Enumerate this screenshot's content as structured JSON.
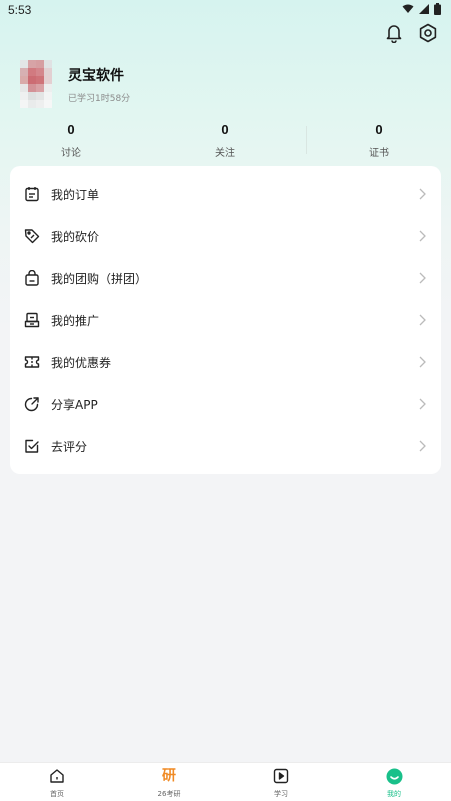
{
  "status": {
    "time": "5:53",
    "icons": [
      "wifi-icon",
      "signal-icon",
      "battery-icon"
    ]
  },
  "header": {
    "icons": [
      "bell-icon",
      "settings-icon"
    ]
  },
  "profile": {
    "name": "灵宝软件",
    "study_time": "已学习1时58分"
  },
  "stats": [
    {
      "value": "0",
      "label": "讨论"
    },
    {
      "value": "0",
      "label": "关注"
    },
    {
      "value": "0",
      "label": "证书"
    }
  ],
  "menu": [
    {
      "label": "我的订单",
      "icon": "order-icon"
    },
    {
      "label": "我的砍价",
      "icon": "bargain-tag-icon"
    },
    {
      "label": "我的团购（拼团）",
      "icon": "group-buy-bag-icon"
    },
    {
      "label": "我的推广",
      "icon": "promotion-icon"
    },
    {
      "label": "我的优惠券",
      "icon": "coupon-icon"
    },
    {
      "label": "分享APP",
      "icon": "share-icon"
    },
    {
      "label": "去评分",
      "icon": "rate-icon"
    }
  ],
  "tabs": [
    {
      "label": "首页",
      "icon": "home-icon",
      "active": false
    },
    {
      "label": "26考研",
      "icon": "研",
      "active": false
    },
    {
      "label": "学习",
      "icon": "play-icon",
      "active": false
    },
    {
      "label": "我的",
      "icon": "profile-face-icon",
      "active": true
    }
  ],
  "colors": {
    "accent": "#19c08a",
    "orange": "#f08a24",
    "gradient_top": "#d6f3ef"
  }
}
